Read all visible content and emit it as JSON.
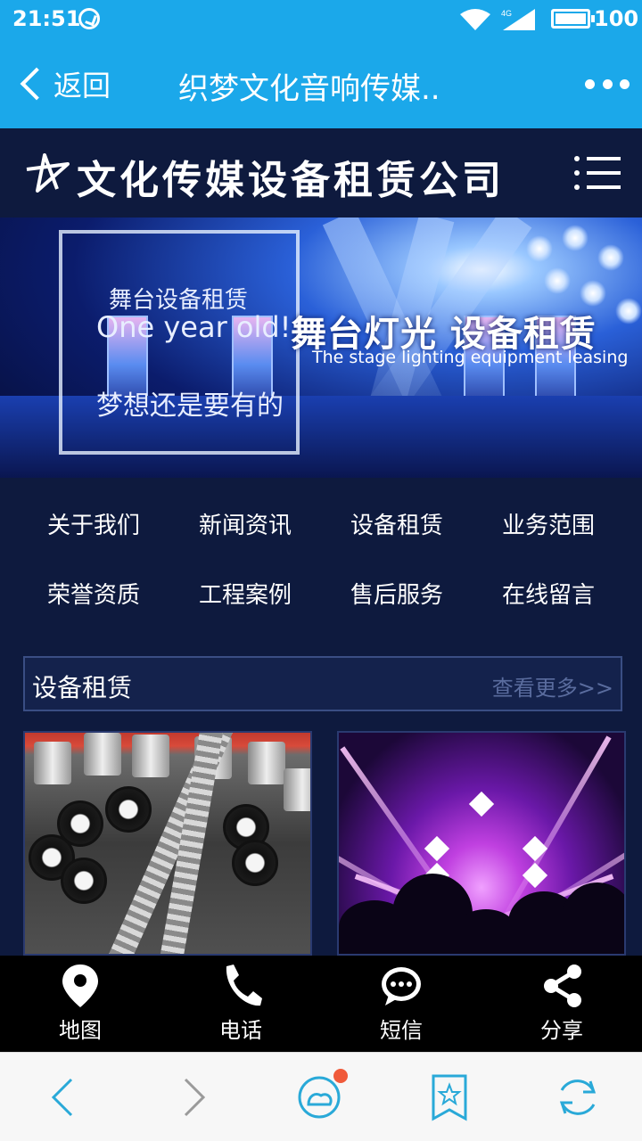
{
  "status_bar": {
    "time": "21:51",
    "network": "4G",
    "battery": "100"
  },
  "app_bar": {
    "back_label": "返回",
    "title": "织梦文化音响传媒.."
  },
  "site": {
    "name": "文化传媒设备租赁公司"
  },
  "banner": {
    "line1": "舞台设备租赁",
    "line2": "One year old!",
    "line3": "梦想还是要有的",
    "headline": "舞台灯光  设备租赁",
    "subline": "The stage lighting equipment leasing"
  },
  "nav": [
    {
      "label": "关于我们"
    },
    {
      "label": "新闻资讯"
    },
    {
      "label": "设备租赁"
    },
    {
      "label": "业务范围"
    },
    {
      "label": "荣誉资质"
    },
    {
      "label": "工程案例"
    },
    {
      "label": "售后服务"
    },
    {
      "label": "在线留言"
    }
  ],
  "section": {
    "title": "设备租赁",
    "more": "查看更多>>"
  },
  "contact_bar": [
    {
      "label": "地图",
      "icon": "map-pin-icon"
    },
    {
      "label": "电话",
      "icon": "phone-icon"
    },
    {
      "label": "短信",
      "icon": "chat-bubble-icon"
    },
    {
      "label": "分享",
      "icon": "share-icon"
    }
  ],
  "colors": {
    "accent": "#1ba8ea",
    "page_bg": "#0e1a3e",
    "notification": "#f05a3a"
  }
}
